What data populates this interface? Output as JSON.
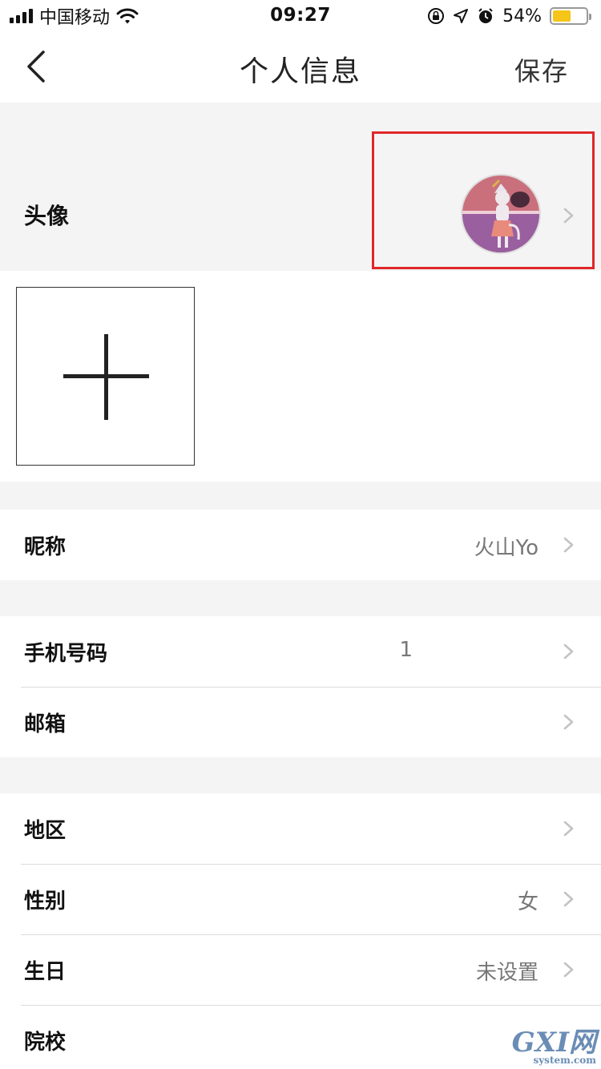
{
  "status_bar": {
    "carrier": "中国移动",
    "time": "09:27",
    "battery_percent": "54%",
    "battery_level": 0.54,
    "icons": [
      "signal-icon",
      "wifi-icon",
      "rotation-lock-icon",
      "location-icon",
      "alarm-icon",
      "battery-icon"
    ]
  },
  "nav": {
    "title": "个人信息",
    "save_label": "保存",
    "back_icon": "chevron-left-icon"
  },
  "avatar": {
    "label": "头像"
  },
  "add_photo": {
    "icon": "plus-icon"
  },
  "sections": [
    {
      "rows": [
        {
          "label": "昵称",
          "value": "火山Yo"
        }
      ]
    },
    {
      "rows": [
        {
          "label": "手机号码",
          "value": "1"
        },
        {
          "label": "邮箱",
          "value": ""
        }
      ]
    },
    {
      "rows": [
        {
          "label": "地区",
          "value": ""
        },
        {
          "label": "性别",
          "value": "女"
        },
        {
          "label": "生日",
          "value": "未设置"
        },
        {
          "label": "院校",
          "value": ""
        }
      ]
    }
  ],
  "watermark": {
    "main": "GXI网",
    "sub": "system.com"
  },
  "colors": {
    "highlight_border": "#e0262a",
    "battery_fill": "#f5c518",
    "chevron": "#c3c3c3"
  }
}
